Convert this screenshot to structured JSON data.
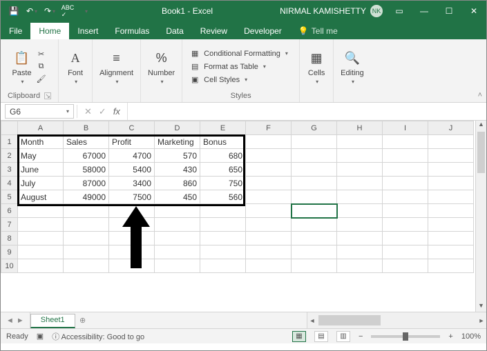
{
  "titlebar": {
    "title": "Book1 - Excel",
    "user": "NIRMAL KAMISHETTY",
    "initials": "NK"
  },
  "tabs": {
    "file": "File",
    "home": "Home",
    "insert": "Insert",
    "formulas": "Formulas",
    "data": "Data",
    "review": "Review",
    "developer": "Developer",
    "tellme": "Tell me"
  },
  "ribbon": {
    "clipboard": {
      "label": "Clipboard",
      "paste": "Paste"
    },
    "font": {
      "label": "Font"
    },
    "alignment": {
      "label": "Alignment"
    },
    "number": {
      "label": "Number"
    },
    "styles": {
      "label": "Styles",
      "cond": "Conditional Formatting",
      "table": "Format as Table",
      "cell": "Cell Styles"
    },
    "cells": {
      "label": "Cells"
    },
    "editing": {
      "label": "Editing"
    }
  },
  "namebox": {
    "value": "G6"
  },
  "columns": [
    "A",
    "B",
    "C",
    "D",
    "E",
    "F",
    "G",
    "H",
    "I",
    "J"
  ],
  "rows": [
    "1",
    "2",
    "3",
    "4",
    "5",
    "6",
    "7",
    "8",
    "9",
    "10"
  ],
  "sheet": {
    "name": "Sheet1"
  },
  "status": {
    "ready": "Ready",
    "access": "Accessibility: Good to go",
    "zoom": "100%"
  },
  "chart_data": {
    "type": "table",
    "headers": [
      "Month",
      "Sales",
      "Profit",
      "Marketing",
      "Bonus"
    ],
    "rows": [
      [
        "May",
        67000,
        4700,
        570,
        680
      ],
      [
        "June",
        58000,
        5400,
        430,
        650
      ],
      [
        "July",
        87000,
        3400,
        860,
        750
      ],
      [
        "August",
        49000,
        7500,
        450,
        560
      ]
    ]
  }
}
